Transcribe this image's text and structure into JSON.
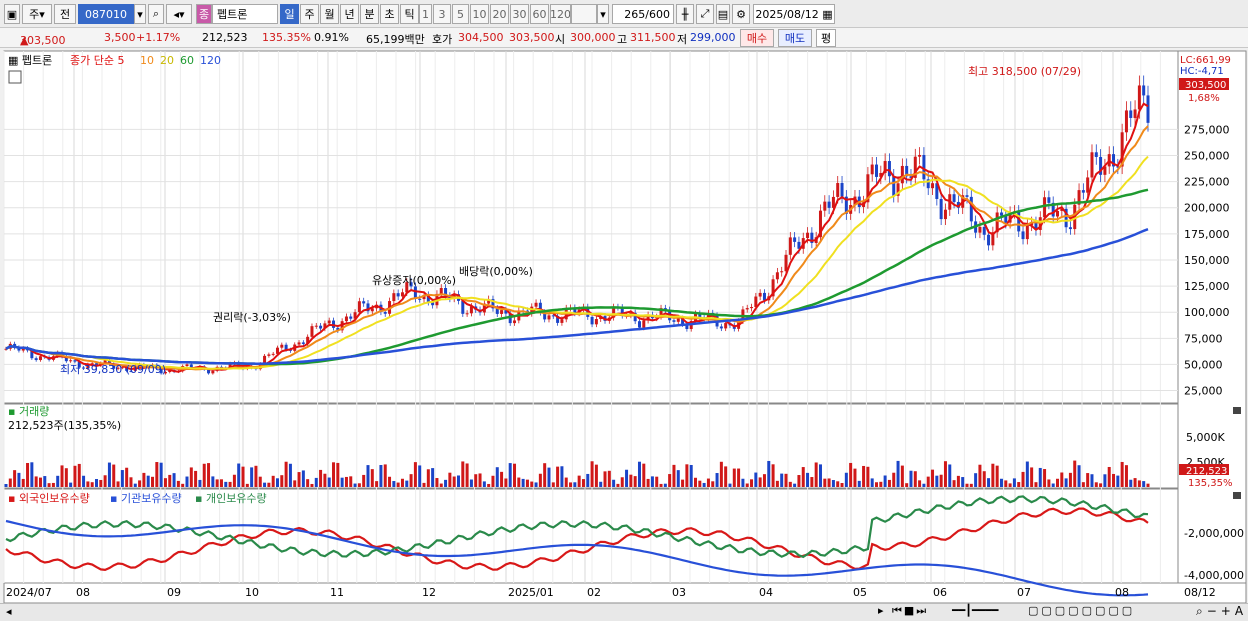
{
  "toolbar": {
    "period": "주",
    "nav": "전",
    "code": "087010",
    "stock_name": "펩트론",
    "stock_badge": "종",
    "tf": [
      "일",
      "주",
      "월",
      "년",
      "분",
      "초",
      "틱"
    ],
    "nums": [
      "1",
      "3",
      "5",
      "10",
      "20",
      "30",
      "60",
      "120"
    ],
    "count": "265",
    "total": "/600",
    "date": "2025/08/12"
  },
  "quote": {
    "price": "303,500",
    "arrow": "▲",
    "change": "3,500",
    "pct": "+1.17%",
    "volume": "212,523",
    "vol_ratio": "135.35%",
    "turnover": "0.91%",
    "amount": "65,199백만",
    "ask_label": "호가",
    "ask1": "304,500",
    "ask2": "303,500",
    "open_label": "시",
    "open": "300,000",
    "high_label": "고",
    "high": "311,500",
    "low_label": "저",
    "low": "299,000",
    "buy": "매수",
    "sell": "매도",
    "eval": "평"
  },
  "legend_price": {
    "name": "펩트론",
    "close_label": "종가 단순",
    "ma5": "5",
    "ma10": "10",
    "ma20": "20",
    "ma60": "60",
    "ma120": "120"
  },
  "legend_vol": {
    "name": "거래량",
    "value": "212,523주(135,35%)"
  },
  "legend_hold": {
    "s1": "외국인보유수량",
    "s2": "기관보유수량",
    "s3": "개인보유수량"
  },
  "colors": {
    "up": "#d01818",
    "down": "#1a44c8",
    "ma5": "#e01010",
    "ma10": "#f08a1a",
    "ma20": "#f0e020",
    "ma60": "#1e9a30",
    "ma120": "#2850d8",
    "foreign": "#d81818",
    "inst": "#2a8a4a",
    "indiv": "#2850d8"
  },
  "chart_data": [
    {
      "type": "candlestick",
      "title": "펩트론",
      "yticks": [
        "275,000",
        "250,000",
        "225,000",
        "200,000",
        "175,000",
        "150,000",
        "125,000",
        "100,000",
        "75,000",
        "50,000",
        "25,000"
      ],
      "ylim": [
        15000,
        350000
      ],
      "xticks": [
        "2024/07",
        "08",
        "09",
        "10",
        "11",
        "12",
        "2025/01",
        "02",
        "03",
        "04",
        "05",
        "06",
        "07",
        "08",
        "08/12"
      ],
      "close_series": {
        "x": [
          "2024/07",
          "08",
          "09",
          "10",
          "11",
          "12",
          "2025/01",
          "02",
          "03",
          "04",
          "05",
          "06",
          "07",
          "08",
          "08/12"
        ],
        "values": [
          65000,
          50000,
          45000,
          48000,
          90000,
          120000,
          100000,
          98000,
          95000,
          90000,
          195000,
          240000,
          180000,
          195000,
          303500
        ]
      },
      "annotations": [
        "최고 318,500 (07/29)",
        "최저 39,830 (09/09)",
        "권리락(-3,03%)",
        "유상증자(0,00%)",
        "배당락(0,00%)"
      ],
      "labels": {
        "lc": "LC:661,99",
        "hc": "HC:-4,71",
        "last": "303,500",
        "last_pct": "1,68%"
      }
    },
    {
      "type": "bar",
      "title": "거래량",
      "yticks": [
        "5,000K",
        "2,500K"
      ],
      "last": "212,523",
      "last_pct": "135,35%"
    },
    {
      "type": "line",
      "title": "보유수량",
      "yticks": [
        "-2,000,000",
        "-4,000,000"
      ],
      "series": [
        {
          "name": "외국인보유수량"
        },
        {
          "name": "기관보유수량"
        },
        {
          "name": "개인보유수량"
        }
      ]
    }
  ]
}
